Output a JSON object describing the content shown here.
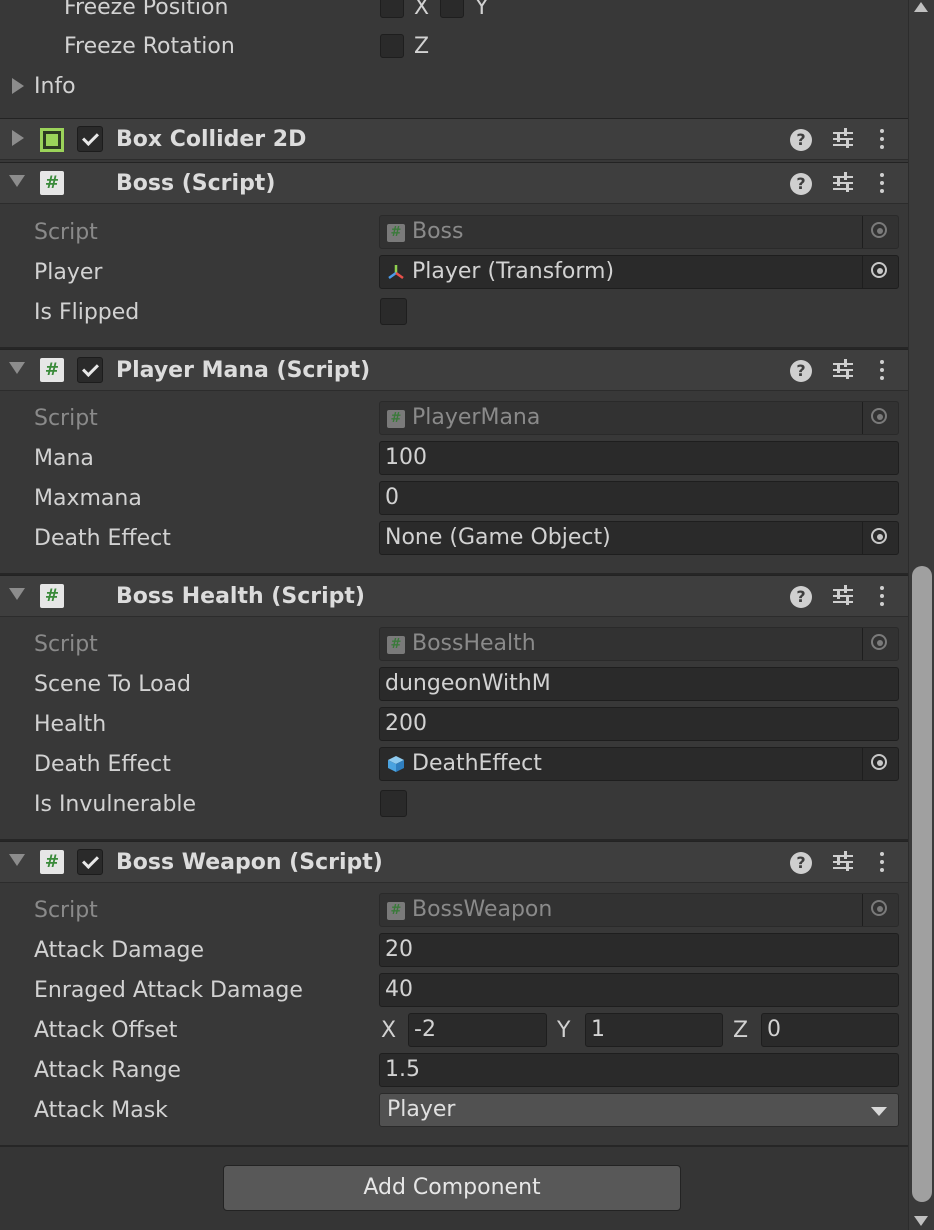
{
  "rigidbody": {
    "freeze_position_label": "Freeze Position",
    "freeze_position_axes": [
      "X",
      "Y"
    ],
    "freeze_rotation_label": "Freeze Rotation",
    "freeze_rotation_axis": "Z",
    "info_label": "Info"
  },
  "box_collider": {
    "title": "Box Collider 2D",
    "enabled": true
  },
  "boss_script": {
    "title": "Boss (Script)",
    "script_label": "Script",
    "script_value": "Boss",
    "player_label": "Player",
    "player_value": "Player  (Transform)",
    "is_flipped_label": "Is Flipped"
  },
  "player_mana": {
    "title": "Player Mana (Script)",
    "enabled": true,
    "script_label": "Script",
    "script_value": "PlayerMana",
    "mana_label": "Mana",
    "mana_value": "100",
    "maxmana_label": "Maxmana",
    "maxmana_value": "0",
    "death_effect_label": "Death Effect",
    "death_effect_value": "None (Game Object)"
  },
  "boss_health": {
    "title": "Boss Health (Script)",
    "script_label": "Script",
    "script_value": "BossHealth",
    "scene_label": "Scene To Load",
    "scene_value": "dungeonWithM",
    "health_label": "Health",
    "health_value": "200",
    "death_effect_label": "Death Effect",
    "death_effect_value": "DeathEffect",
    "invulnerable_label": "Is Invulnerable"
  },
  "boss_weapon": {
    "title": "Boss Weapon (Script)",
    "enabled": true,
    "script_label": "Script",
    "script_value": "BossWeapon",
    "attack_damage_label": "Attack Damage",
    "attack_damage_value": "20",
    "enraged_label": "Enraged Attack Damage",
    "enraged_value": "40",
    "offset_label": "Attack Offset",
    "offset": {
      "x_label": "X",
      "x": "-2",
      "y_label": "Y",
      "y": "1",
      "z_label": "Z",
      "z": "0"
    },
    "range_label": "Attack Range",
    "range_value": "1.5",
    "mask_label": "Attack Mask",
    "mask_value": "Player"
  },
  "footer": {
    "add_component": "Add Component"
  },
  "header_icons": {
    "help": "?",
    "script_glyph": "#"
  },
  "colors": {
    "background": "#383838",
    "header": "#3e3e3e",
    "field": "#2a2a2a",
    "script_green": "#3a8a3a",
    "collider_green": "#9bd35a"
  }
}
